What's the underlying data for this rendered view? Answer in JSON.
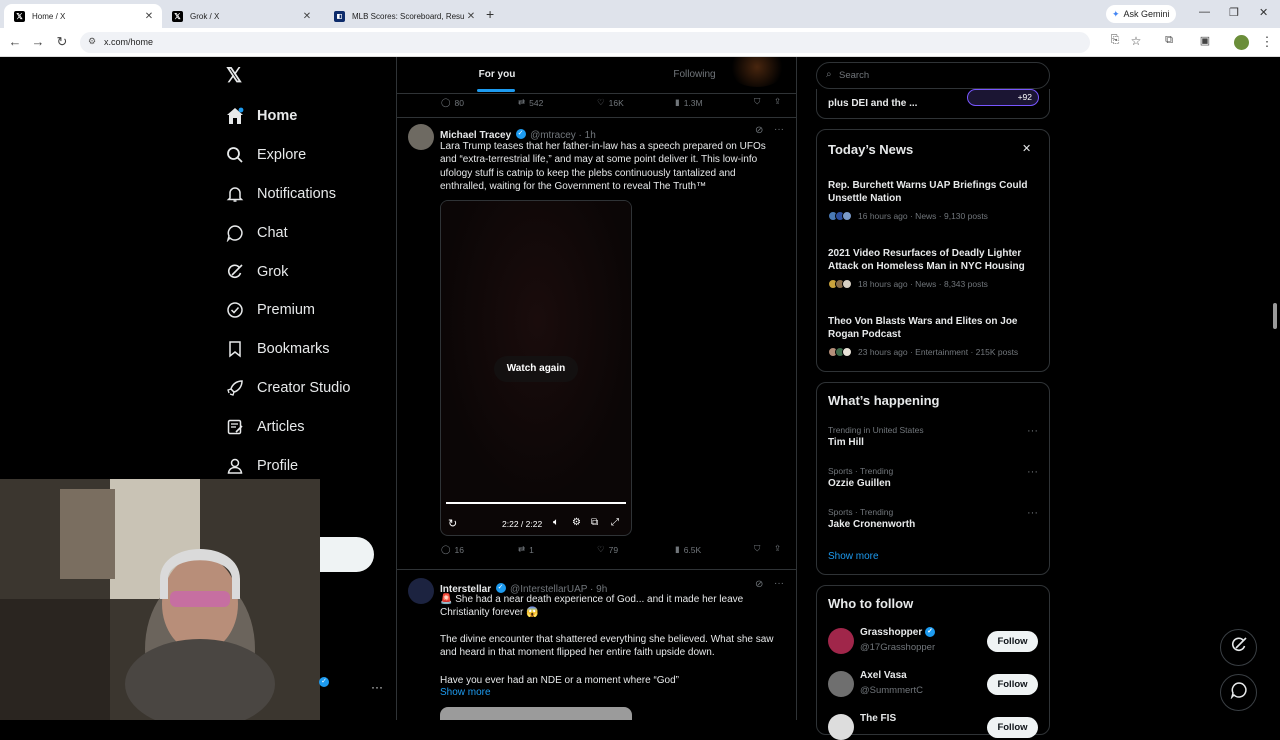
{
  "browser": {
    "tabs": [
      {
        "title": "Home / X",
        "icon": "x-logo"
      },
      {
        "title": "Grok / X",
        "icon": "x-logo"
      },
      {
        "title": "MLB Scores: Scoreboard, Results",
        "icon": "mlb-logo"
      }
    ],
    "url": "x.com/home",
    "ask_gemini": "Ask Gemini"
  },
  "sidebar": {
    "items": [
      {
        "label": "Home",
        "icon": "home-icon"
      },
      {
        "label": "Explore",
        "icon": "search-icon"
      },
      {
        "label": "Notifications",
        "icon": "bell-icon"
      },
      {
        "label": "Chat",
        "icon": "chat-icon"
      },
      {
        "label": "Grok",
        "icon": "grok-icon"
      },
      {
        "label": "Premium",
        "icon": "premium-icon"
      },
      {
        "label": "Bookmarks",
        "icon": "bookmark-icon"
      },
      {
        "label": "Creator Studio",
        "icon": "rocket-icon"
      },
      {
        "label": "Articles",
        "icon": "articles-icon"
      },
      {
        "label": "Profile",
        "icon": "person-icon"
      }
    ]
  },
  "feed": {
    "tabs": [
      "For you",
      "Following"
    ],
    "top_actions": {
      "replies": "80",
      "reposts": "542",
      "likes": "16K",
      "views": "1.3M"
    },
    "post1": {
      "name": "Michael Tracey",
      "handle": "@mtracey · 1h",
      "text": "Lara Trump teases that her father-in-law has a speech prepared on UFOs and “extra-terrestrial life,” and may at some point deliver it. This low-info ufology stuff is catnip to keep the plebs continuously tantalized and enthralled, waiting for the Government to reveal The Truth™",
      "video": {
        "overlay": "Watch again",
        "time": "2:22 / 2:22",
        "progress": 1.0
      },
      "actions": {
        "replies": "16",
        "reposts": "1",
        "likes": "79",
        "views": "6.5K"
      }
    },
    "post2": {
      "name": "Interstellar",
      "handle": "@InterstellarUAP · 9h",
      "line1": "🚨 She had a near death experience of God... and it made her leave Christianity forever 😱",
      "line2": "The divine encounter that shattered everything she believed.   What she saw and heard in that moment flipped her entire faith upside down.",
      "line3": "Have you ever had an NDE or a moment where “God”",
      "show_more": "Show more"
    }
  },
  "right": {
    "search_placeholder": "Search",
    "spaces_text": "plus DEI and the ...",
    "spaces_count": "+92",
    "news": {
      "title": "Today’s News",
      "items": [
        {
          "title": "Rep. Burchett Warns UAP Briefings Could Unsettle Nation",
          "meta": "16 hours ago · News · 9,130 posts"
        },
        {
          "title": "2021 Video Resurfaces of Deadly Lighter Attack on Homeless Man in NYC Housing",
          "meta": "18 hours ago · News · 8,343 posts"
        },
        {
          "title": "Theo Von Blasts Wars and Elites on Joe Rogan Podcast",
          "meta": "23 hours ago · Entertainment · 215K posts"
        }
      ]
    },
    "happening": {
      "title": "What’s happening",
      "items": [
        {
          "context": "Trending in United States",
          "topic": "Tim Hill"
        },
        {
          "context": "Sports · Trending",
          "topic": "Ozzie Guillen"
        },
        {
          "context": "Sports · Trending",
          "topic": "Jake Cronenworth"
        }
      ],
      "show_more": "Show more"
    },
    "follow": {
      "title": "Who to follow",
      "items": [
        {
          "name": "Grasshopper",
          "handle": "@17Grasshopper",
          "button": "Follow"
        },
        {
          "name": "Axel Vasa",
          "handle": "@SummmertC",
          "button": "Follow"
        },
        {
          "name": "The FIS",
          "handle": "",
          "button": "Follow"
        }
      ]
    }
  },
  "colors": {
    "accent": "#1d9bf0",
    "background": "#000000",
    "border": "#2f3336",
    "muted": "#71767b"
  }
}
